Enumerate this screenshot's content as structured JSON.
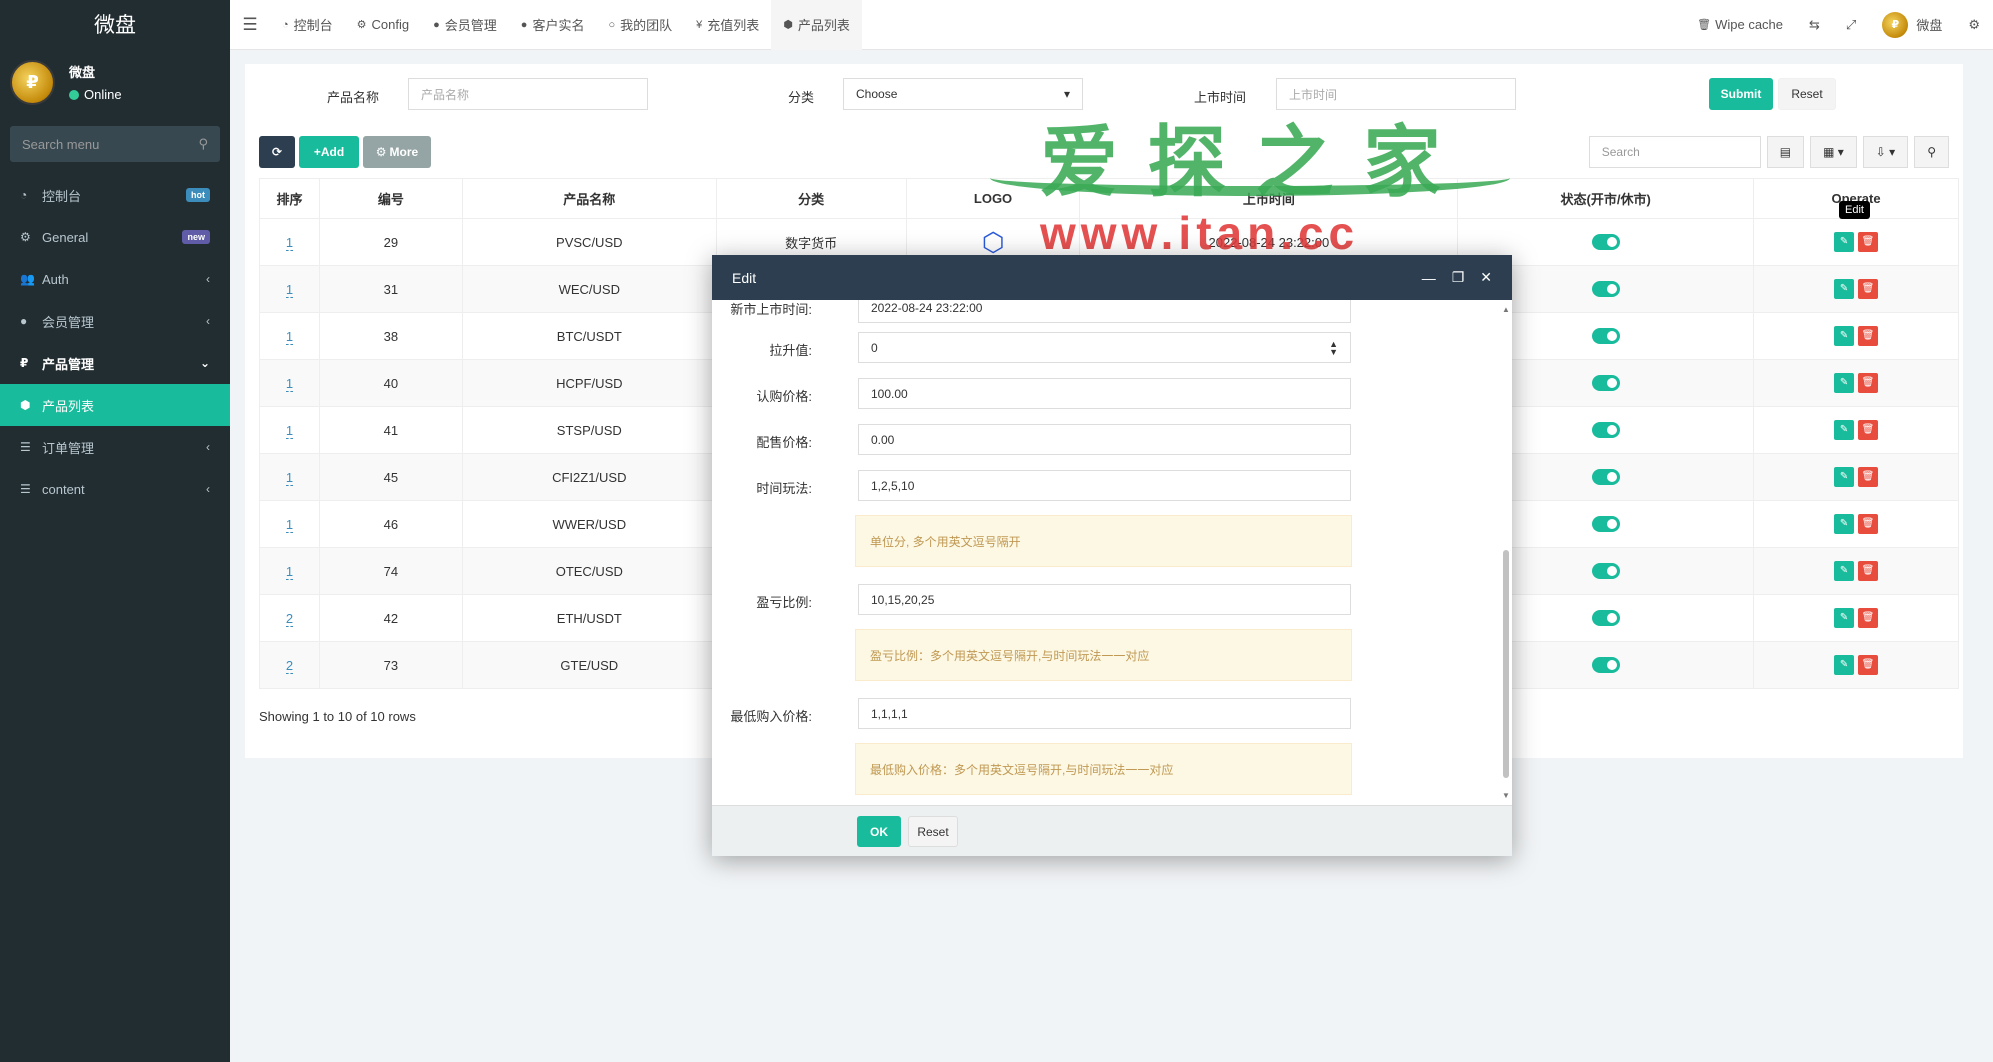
{
  "app": {
    "brand": "微盘"
  },
  "user": {
    "name": "微盘",
    "status": "Online"
  },
  "sidebar": {
    "search_placeholder": "Search menu",
    "items": [
      {
        "label": "控制台",
        "icon": "dashboard-icon",
        "badge": "hot"
      },
      {
        "label": "General",
        "icon": "cogs-icon",
        "badge": "new"
      },
      {
        "label": "Auth",
        "icon": "group-icon",
        "arrow": "‹"
      },
      {
        "label": "会员管理",
        "icon": "user-circle-icon",
        "arrow": "‹"
      },
      {
        "label": "产品管理",
        "icon": "rouble-icon",
        "arrow": "⌄"
      },
      {
        "label": "产品列表",
        "icon": "cubes-icon"
      },
      {
        "label": "订单管理",
        "icon": "list-icon",
        "arrow": "‹"
      },
      {
        "label": "content",
        "icon": "list-icon",
        "arrow": "‹"
      }
    ]
  },
  "topnav": {
    "tabs": [
      {
        "label": "控制台",
        "icon": "dashboard-icon"
      },
      {
        "label": "Config",
        "icon": "cog-icon"
      },
      {
        "label": "会员管理",
        "icon": "user-icon"
      },
      {
        "label": "客户实名",
        "icon": "user-icon"
      },
      {
        "label": "我的团队",
        "icon": "circle-icon"
      },
      {
        "label": "充值列表",
        "icon": "yen-icon"
      },
      {
        "label": "产品列表",
        "icon": "cubes-icon"
      }
    ],
    "wipe_cache": "Wipe cache",
    "username": "微盘"
  },
  "filter": {
    "name_label": "产品名称",
    "name_placeholder": "产品名称",
    "category_label": "分类",
    "category_value": "Choose",
    "time_label": "上市时间",
    "time_placeholder": "上市时间",
    "submit": "Submit",
    "reset": "Reset"
  },
  "toolbar": {
    "add": "Add",
    "more": "More",
    "search_placeholder": "Search"
  },
  "table": {
    "headers": [
      "排序",
      "编号",
      "产品名称",
      "分类",
      "LOGO",
      "上市时间",
      "状态(开市/休市)",
      "Operate"
    ],
    "rows": [
      {
        "sort": "1",
        "id": "29",
        "name": "PVSC/USD",
        "category": "数字货币",
        "time": "2022-08-24 23:22:00"
      },
      {
        "sort": "1",
        "id": "31",
        "name": "WEC/USD"
      },
      {
        "sort": "1",
        "id": "38",
        "name": "BTC/USDT"
      },
      {
        "sort": "1",
        "id": "40",
        "name": "HCPF/USD"
      },
      {
        "sort": "1",
        "id": "41",
        "name": "STSP/USD"
      },
      {
        "sort": "1",
        "id": "45",
        "name": "CFI2Z1/USD"
      },
      {
        "sort": "1",
        "id": "46",
        "name": "WWER/USD"
      },
      {
        "sort": "1",
        "id": "74",
        "name": "OTEC/USD"
      },
      {
        "sort": "2",
        "id": "42",
        "name": "ETH/USDT"
      },
      {
        "sort": "2",
        "id": "73",
        "name": "GTE/USD"
      }
    ],
    "showing": "Showing 1 to 10 of 10 rows",
    "tooltip": "Edit"
  },
  "watermark": {
    "line1": "爱 探 之 家",
    "line2": "www.itan.cc"
  },
  "modal": {
    "title": "Edit",
    "partial_label": "新市上市时间:",
    "partial_value": "2022-08-24 23:22:00",
    "fields": [
      {
        "label": "拉升值:",
        "value": "0"
      },
      {
        "label": "认购价格:",
        "value": "100.00"
      },
      {
        "label": "配售价格:",
        "value": "0.00"
      },
      {
        "label": "时间玩法:",
        "value": "1,2,5,10"
      },
      {
        "label": "盈亏比例:",
        "value": "10,15,20,25"
      },
      {
        "label": "最低购入价格:",
        "value": "1,1,1,1"
      }
    ],
    "help": [
      "单位分, 多个用英文逗号隔开",
      "盈亏比例：多个用英文逗号隔开,与时间玩法一一对应",
      "最低购入价格：多个用英文逗号隔开,与时间玩法一一对应"
    ],
    "ok": "OK",
    "reset": "Reset"
  }
}
